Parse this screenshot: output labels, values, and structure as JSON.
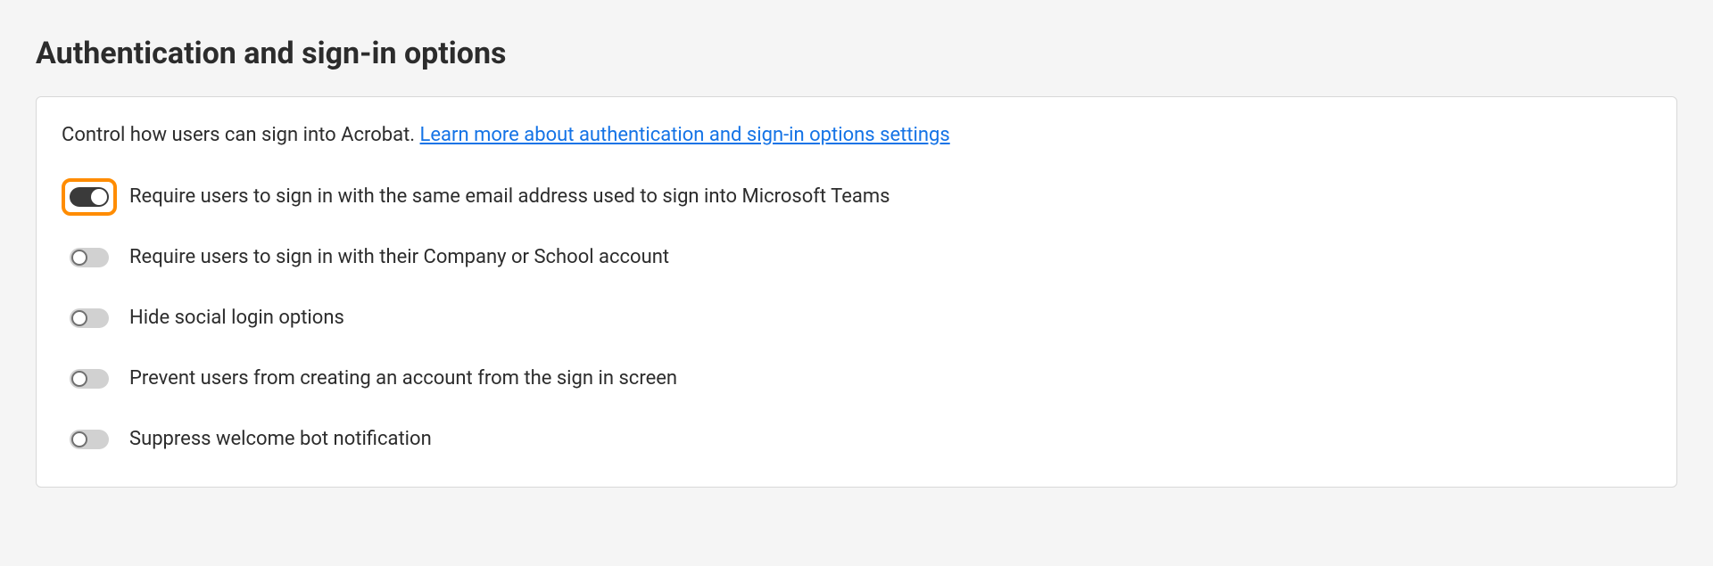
{
  "title": "Authentication and sign-in options",
  "description_prefix": "Control how users can sign into Acrobat. ",
  "description_link": "Learn more about authentication and sign-in options settings",
  "options": [
    {
      "label": "Require users to sign in with the same email address used to sign into Microsoft Teams",
      "on": true,
      "highlighted": true
    },
    {
      "label": "Require users to sign in with their Company or School account",
      "on": false,
      "highlighted": false
    },
    {
      "label": "Hide social login options",
      "on": false,
      "highlighted": false
    },
    {
      "label": "Prevent users from creating an account from the sign in screen",
      "on": false,
      "highlighted": false
    },
    {
      "label": "Suppress welcome bot notification",
      "on": false,
      "highlighted": false
    }
  ]
}
